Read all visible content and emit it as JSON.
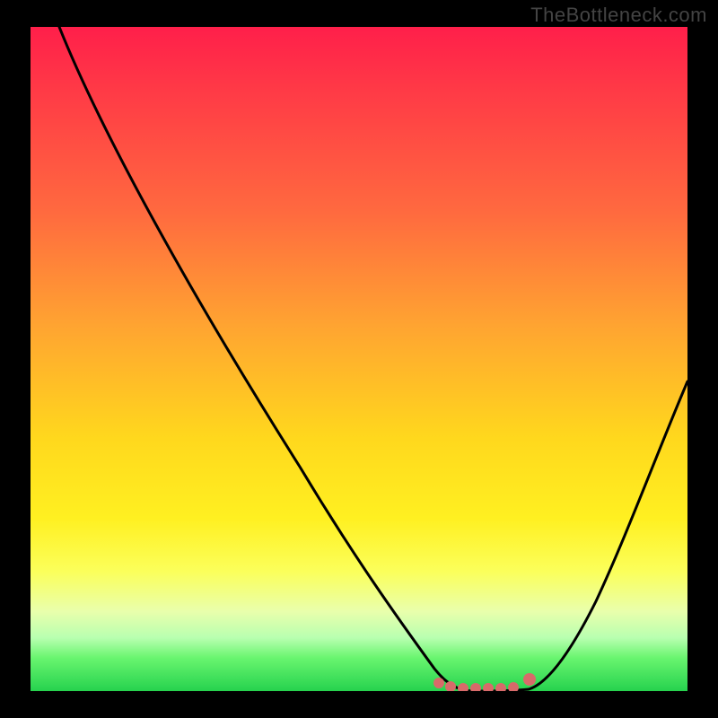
{
  "watermark": "TheBottleneck.com",
  "chart_data": {
    "type": "line",
    "title": "",
    "xlabel": "",
    "ylabel": "",
    "xlim": [
      0,
      100
    ],
    "ylim": [
      0,
      100
    ],
    "x": [
      0,
      5,
      10,
      15,
      20,
      25,
      30,
      35,
      40,
      45,
      50,
      55,
      60,
      62,
      65,
      68,
      70,
      72,
      74,
      76,
      80,
      85,
      90,
      95,
      100
    ],
    "values": [
      100,
      94,
      87,
      80,
      73,
      66,
      59,
      51,
      44,
      36,
      28,
      20,
      11,
      6,
      2,
      0,
      0,
      0,
      0,
      1,
      6,
      14,
      24,
      35,
      47
    ],
    "markers": [
      {
        "x": 62,
        "y": 0
      },
      {
        "x": 64,
        "y": 0
      },
      {
        "x": 66,
        "y": 0
      },
      {
        "x": 68,
        "y": 0
      },
      {
        "x": 70,
        "y": 0
      },
      {
        "x": 72,
        "y": 0
      },
      {
        "x": 74,
        "y": 0
      },
      {
        "x": 76,
        "y": 0.5
      }
    ],
    "gradient_stops": [
      {
        "pct": 0,
        "color": "#ff1f4a"
      },
      {
        "pct": 28,
        "color": "#ff6a3f"
      },
      {
        "pct": 62,
        "color": "#ffd81d"
      },
      {
        "pct": 82,
        "color": "#fbff5b"
      },
      {
        "pct": 95,
        "color": "#69f56f"
      },
      {
        "pct": 100,
        "color": "#26d24e"
      }
    ]
  }
}
